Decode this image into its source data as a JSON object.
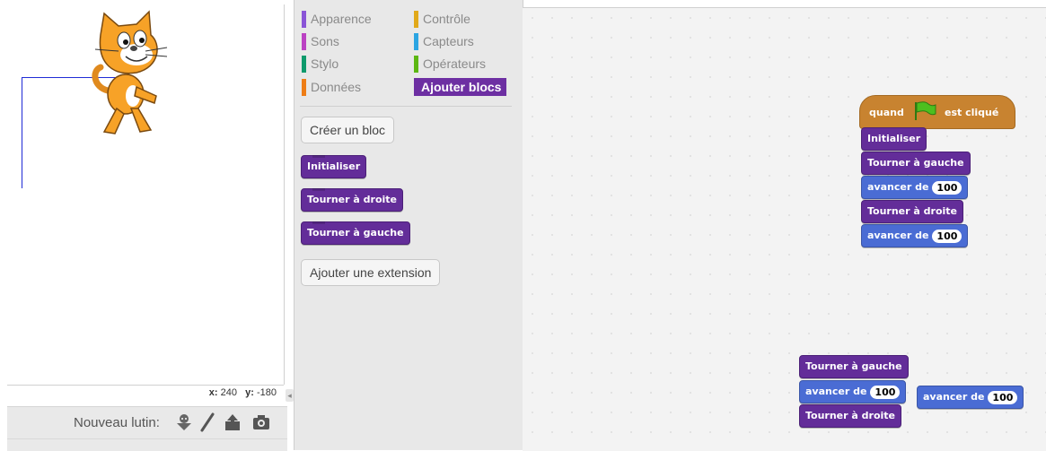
{
  "stage": {
    "coords": {
      "x_label": "x:",
      "x_value": "240",
      "y_label": "y:",
      "y_value": "-180"
    },
    "collapse_glyph": "◂"
  },
  "sprite_bar": {
    "new_sprite_label": "Nouveau lutin:",
    "tools": [
      "sprite-library-icon",
      "paint-brush-icon",
      "upload-icon",
      "camera-icon"
    ]
  },
  "palette": {
    "categories": [
      {
        "label": "Apparence",
        "color": "#8a55d7"
      },
      {
        "label": "Contrôle",
        "color": "#e1a91a"
      },
      {
        "label": "Sons",
        "color": "#bb42c3"
      },
      {
        "label": "Capteurs",
        "color": "#2ca5e2"
      },
      {
        "label": "Stylo",
        "color": "#0e9a6c"
      },
      {
        "label": "Opérateurs",
        "color": "#5cb712"
      },
      {
        "label": "Données",
        "color": "#ee7d16"
      },
      {
        "label": "Ajouter blocs",
        "color": "#632d99"
      }
    ],
    "make_block_button": "Créer un bloc",
    "blocks": [
      "Initialiser",
      "Tourner à droite",
      "Tourner à gauche"
    ],
    "add_extension_button": "Ajouter une extension"
  },
  "scripts": {
    "main": {
      "hat": {
        "prefix": "quand",
        "suffix": "est cliqué"
      },
      "blocks": [
        {
          "label": "Initialiser"
        },
        {
          "label": "Tourner à gauche"
        },
        {
          "label": "avancer de",
          "value": "100"
        },
        {
          "label": "Tourner à droite"
        },
        {
          "label": "avancer de",
          "value": "100"
        }
      ]
    },
    "loose": {
      "blocks": [
        {
          "label": "Tourner à gauche"
        },
        {
          "label": "avancer de",
          "value": "100"
        },
        {
          "label": "Tourner à droite"
        }
      ],
      "detached": {
        "label": "avancer de",
        "value": "100"
      }
    }
  }
}
